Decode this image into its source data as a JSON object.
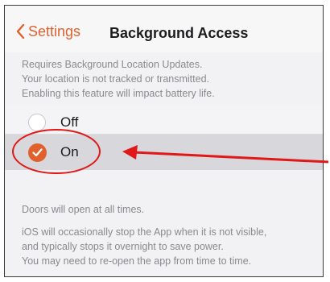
{
  "nav": {
    "back_label": "Settings",
    "title": "Background Access"
  },
  "header_note": "Requires Background Location Updates.\nYour location is not tracked or transmitted.\nEnabling this feature will impact battery life.",
  "options": [
    {
      "label": "Off",
      "selected": false
    },
    {
      "label": "On",
      "selected": true
    }
  ],
  "footer_notes": [
    "Doors will open at all times.",
    "iOS will occasionally stop the App when it is not visible,\nand typically stops it overnight to save power.\nYou may need to re-open the app from time to time."
  ],
  "colors": {
    "accent": "#e0612d",
    "annotation": "#e01818",
    "selected_row": "#d7d7dc"
  },
  "icons": {
    "back": "chevron-left-icon",
    "checked": "checkmark-icon"
  }
}
